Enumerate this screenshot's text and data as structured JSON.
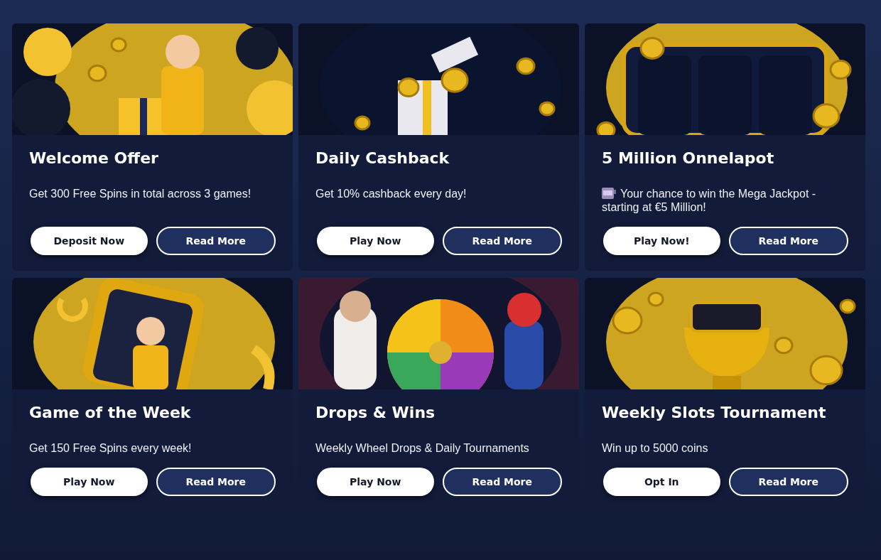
{
  "promotions": [
    {
      "title": "Welcome Offer",
      "description": "Get 300 Free Spins in total across 3 games!",
      "lead_icon": false,
      "buttons": [
        {
          "label": "Deposit Now",
          "kind": "primary"
        },
        {
          "label": "Read More",
          "kind": "secondary"
        }
      ]
    },
    {
      "title": "Daily Cashback",
      "description": "Get 10% cashback every day!",
      "lead_icon": false,
      "buttons": [
        {
          "label": "Play Now",
          "kind": "primary"
        },
        {
          "label": "Read More",
          "kind": "secondary"
        }
      ]
    },
    {
      "title": "5 Million Onnelapot",
      "description": "Your chance to win the Mega Jackpot - starting at €5 Million!",
      "lead_icon": true,
      "buttons": [
        {
          "label": "Play Now!",
          "kind": "primary"
        },
        {
          "label": "Read More",
          "kind": "secondary"
        }
      ]
    },
    {
      "title": "Game of the Week",
      "description": "Get 150 Free Spins every week!",
      "lead_icon": false,
      "buttons": [
        {
          "label": "Play Now",
          "kind": "primary"
        },
        {
          "label": "Read More",
          "kind": "secondary"
        }
      ]
    },
    {
      "title": "Drops & Wins",
      "description": "Weekly Wheel Drops & Daily Tournaments",
      "lead_icon": false,
      "buttons": [
        {
          "label": "Play Now",
          "kind": "primary"
        },
        {
          "label": "Read More",
          "kind": "secondary"
        }
      ]
    },
    {
      "title": "Weekly Slots Tournament",
      "description": "Win up to 5000 coins",
      "lead_icon": false,
      "buttons": [
        {
          "label": "Opt In",
          "kind": "primary"
        },
        {
          "label": "Read More",
          "kind": "secondary"
        }
      ]
    }
  ]
}
